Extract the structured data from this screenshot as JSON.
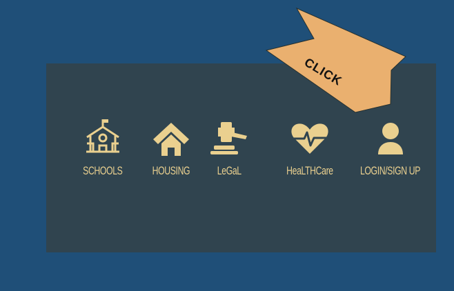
{
  "theme": {
    "background": "#1f4f78",
    "panel": "#30444f",
    "accent": "#ead08f",
    "callout": "#eab06f"
  },
  "nav": {
    "items": [
      {
        "label": "SCHOOLS",
        "icon": "school-icon"
      },
      {
        "label": "HOUSING",
        "icon": "house-icon"
      },
      {
        "label": "LeGaL",
        "icon": "gavel-icon"
      },
      {
        "label": "HeaLTHCare",
        "icon": "heartbeat-icon"
      },
      {
        "label": "LOGIN/SIGN UP",
        "icon": "user-icon"
      }
    ]
  },
  "callout": {
    "text": "CLICK"
  }
}
